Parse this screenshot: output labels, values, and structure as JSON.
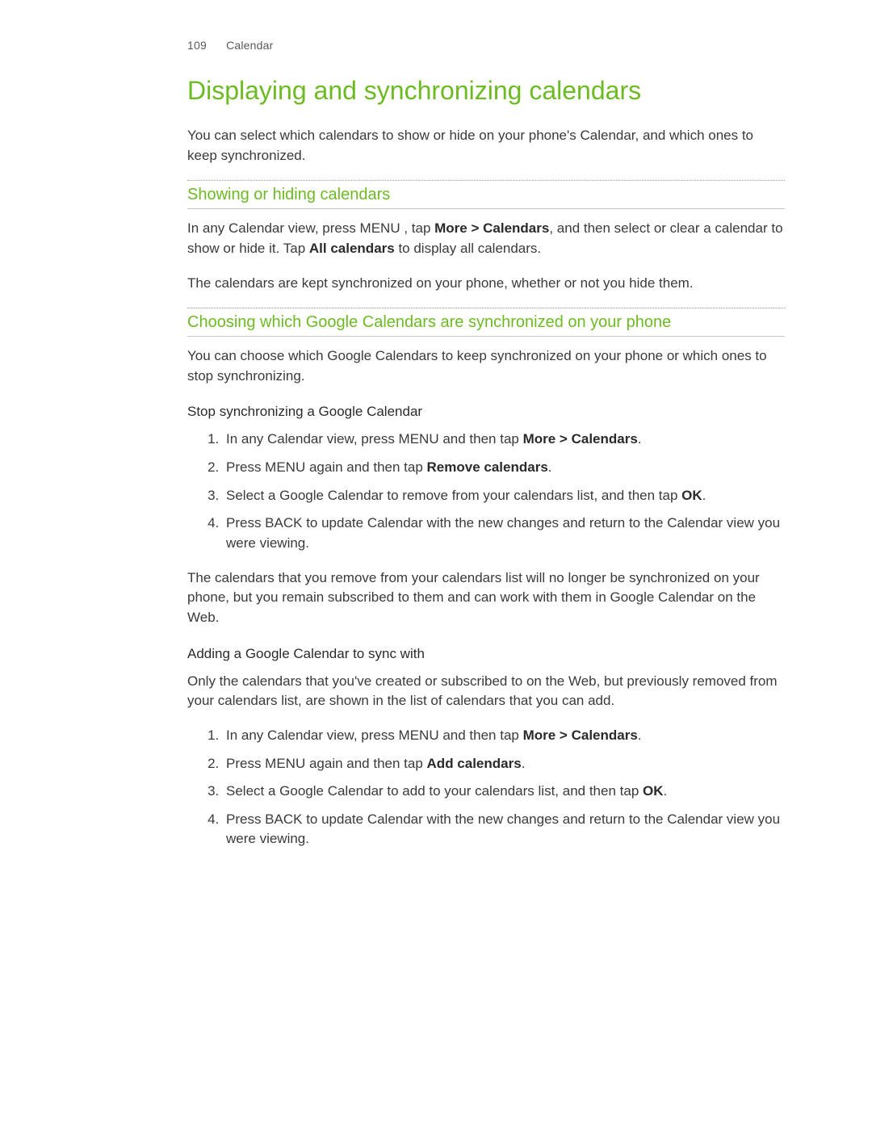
{
  "header": {
    "page_number": "109",
    "section": "Calendar"
  },
  "title": "Displaying and synchronizing calendars",
  "intro": "You can select which calendars to show or hide on your phone's Calendar, and which ones to keep synchronized.",
  "section_showing": {
    "heading": "Showing or hiding calendars",
    "para1": {
      "pre": "In any Calendar view, press MENU , tap ",
      "bold1": "More > Calendars",
      "mid": ", and then select or clear a calendar to show or hide it. Tap ",
      "bold2": "All calendars",
      "post": " to display all calendars."
    },
    "para2": "The calendars are kept synchronized on your phone, whether or not you hide them."
  },
  "section_choosing": {
    "heading": "Choosing which Google Calendars are synchronized on your phone",
    "intro": "You can choose which Google Calendars to keep synchronized on your phone or which ones to stop synchronizing.",
    "stop": {
      "heading": "Stop synchronizing a Google Calendar",
      "steps": [
        {
          "pre": "In any Calendar view, press MENU and then tap ",
          "bold": "More > Calendars",
          "post": "."
        },
        {
          "pre": "Press MENU again and then tap ",
          "bold": "Remove calendars",
          "post": "."
        },
        {
          "pre": "Select a Google Calendar to remove from your calendars list, and then tap ",
          "bold": "OK",
          "post": "."
        },
        {
          "pre": "Press BACK to update Calendar with the new changes and return to the Calendar view you were viewing.",
          "bold": "",
          "post": ""
        }
      ],
      "note": "The calendars that you remove from your calendars list will no longer be synchronized on your phone, but you remain subscribed to them and can work with them in Google Calendar on the Web."
    },
    "add": {
      "heading": "Adding a Google Calendar to sync with",
      "intro": "Only the calendars that you've created or subscribed to on the Web, but previously removed from your calendars list, are shown in the list of calendars that you can add.",
      "steps": [
        {
          "pre": "In any Calendar view, press MENU and then tap ",
          "bold": "More > Calendars",
          "post": "."
        },
        {
          "pre": "Press MENU again and then tap ",
          "bold": "Add calendars",
          "post": "."
        },
        {
          "pre": "Select a Google Calendar to add to your calendars list, and then tap ",
          "bold": "OK",
          "post": "."
        },
        {
          "pre": "Press BACK to update Calendar with the new changes and return to the Calendar view you were viewing.",
          "bold": "",
          "post": ""
        }
      ]
    }
  }
}
